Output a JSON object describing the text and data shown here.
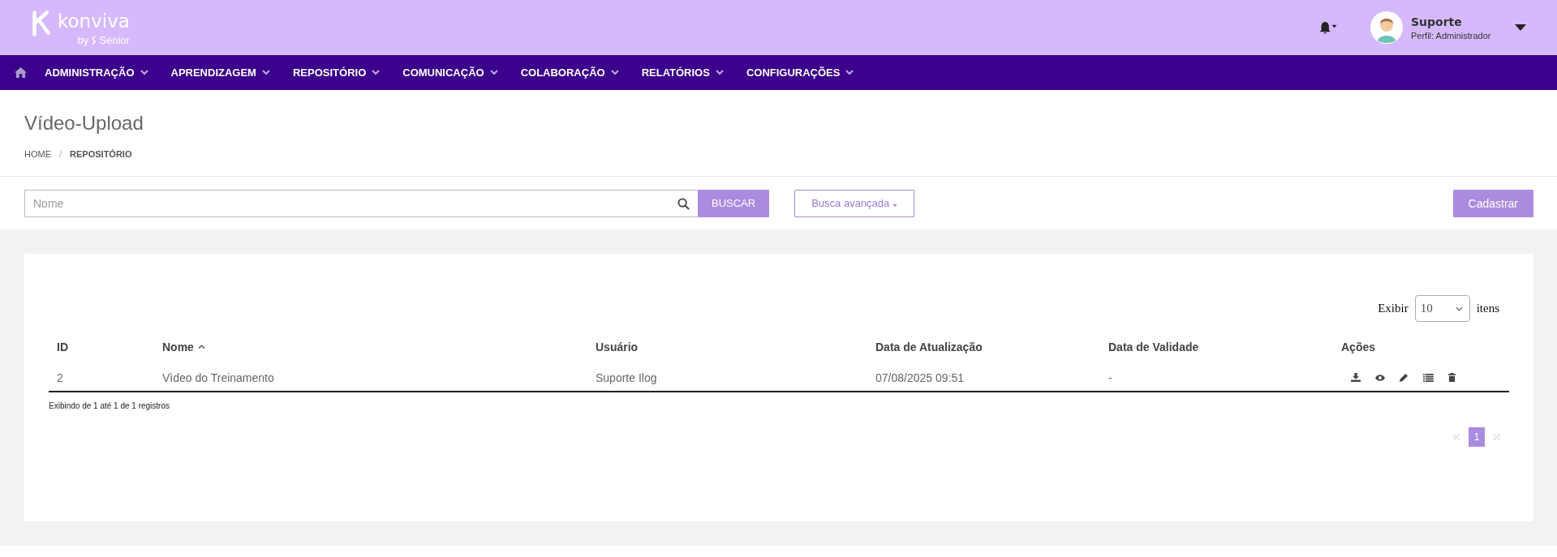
{
  "header": {
    "logo": {
      "name": "konviva",
      "byline": "by",
      "brand": "Senior"
    },
    "user": {
      "name": "Suporte",
      "profile": "Perfil: Administrador"
    }
  },
  "nav": [
    "ADMINISTRAÇÃO",
    "APRENDIZAGEM",
    "REPOSITÓRIO",
    "COMUNICAÇÃO",
    "COLABORAÇÃO",
    "RELATÓRIOS",
    "CONFIGURAÇÕES"
  ],
  "page": {
    "title": "Vídeo-Upload",
    "breadcrumb": [
      {
        "label": "HOME",
        "current": false
      },
      {
        "label": "REPOSITÓRIO",
        "current": true
      }
    ],
    "separator": "/"
  },
  "search": {
    "placeholder": "Nome",
    "button": "BUSCAR",
    "advanced": "Busca avançada",
    "create": "Cadastrar"
  },
  "table": {
    "page_size": {
      "before": "Exibir",
      "value": "10",
      "after": "itens"
    },
    "columns": [
      {
        "label": "ID",
        "sorted": false
      },
      {
        "label": "Nome",
        "sorted": true
      },
      {
        "label": "Usuário",
        "sorted": false
      },
      {
        "label": "Data de Atualização",
        "sorted": false
      },
      {
        "label": "Data de Validade",
        "sorted": false
      },
      {
        "label": "Ações",
        "sorted": false
      }
    ],
    "rows": [
      {
        "cells": [
          "2",
          "Vìdeo do Treinamento",
          "Suporte Ilog",
          "07/08/2025 09:51",
          "-"
        ],
        "actions": [
          {
            "kind": "download"
          },
          {
            "kind": "view"
          },
          {
            "kind": "edit"
          },
          {
            "kind": "list"
          },
          {
            "kind": "delete"
          }
        ]
      }
    ],
    "info": "Exibindo de 1 até 1 de 1 registros",
    "pages": [
      {
        "label": "1",
        "selected": true
      }
    ]
  }
}
